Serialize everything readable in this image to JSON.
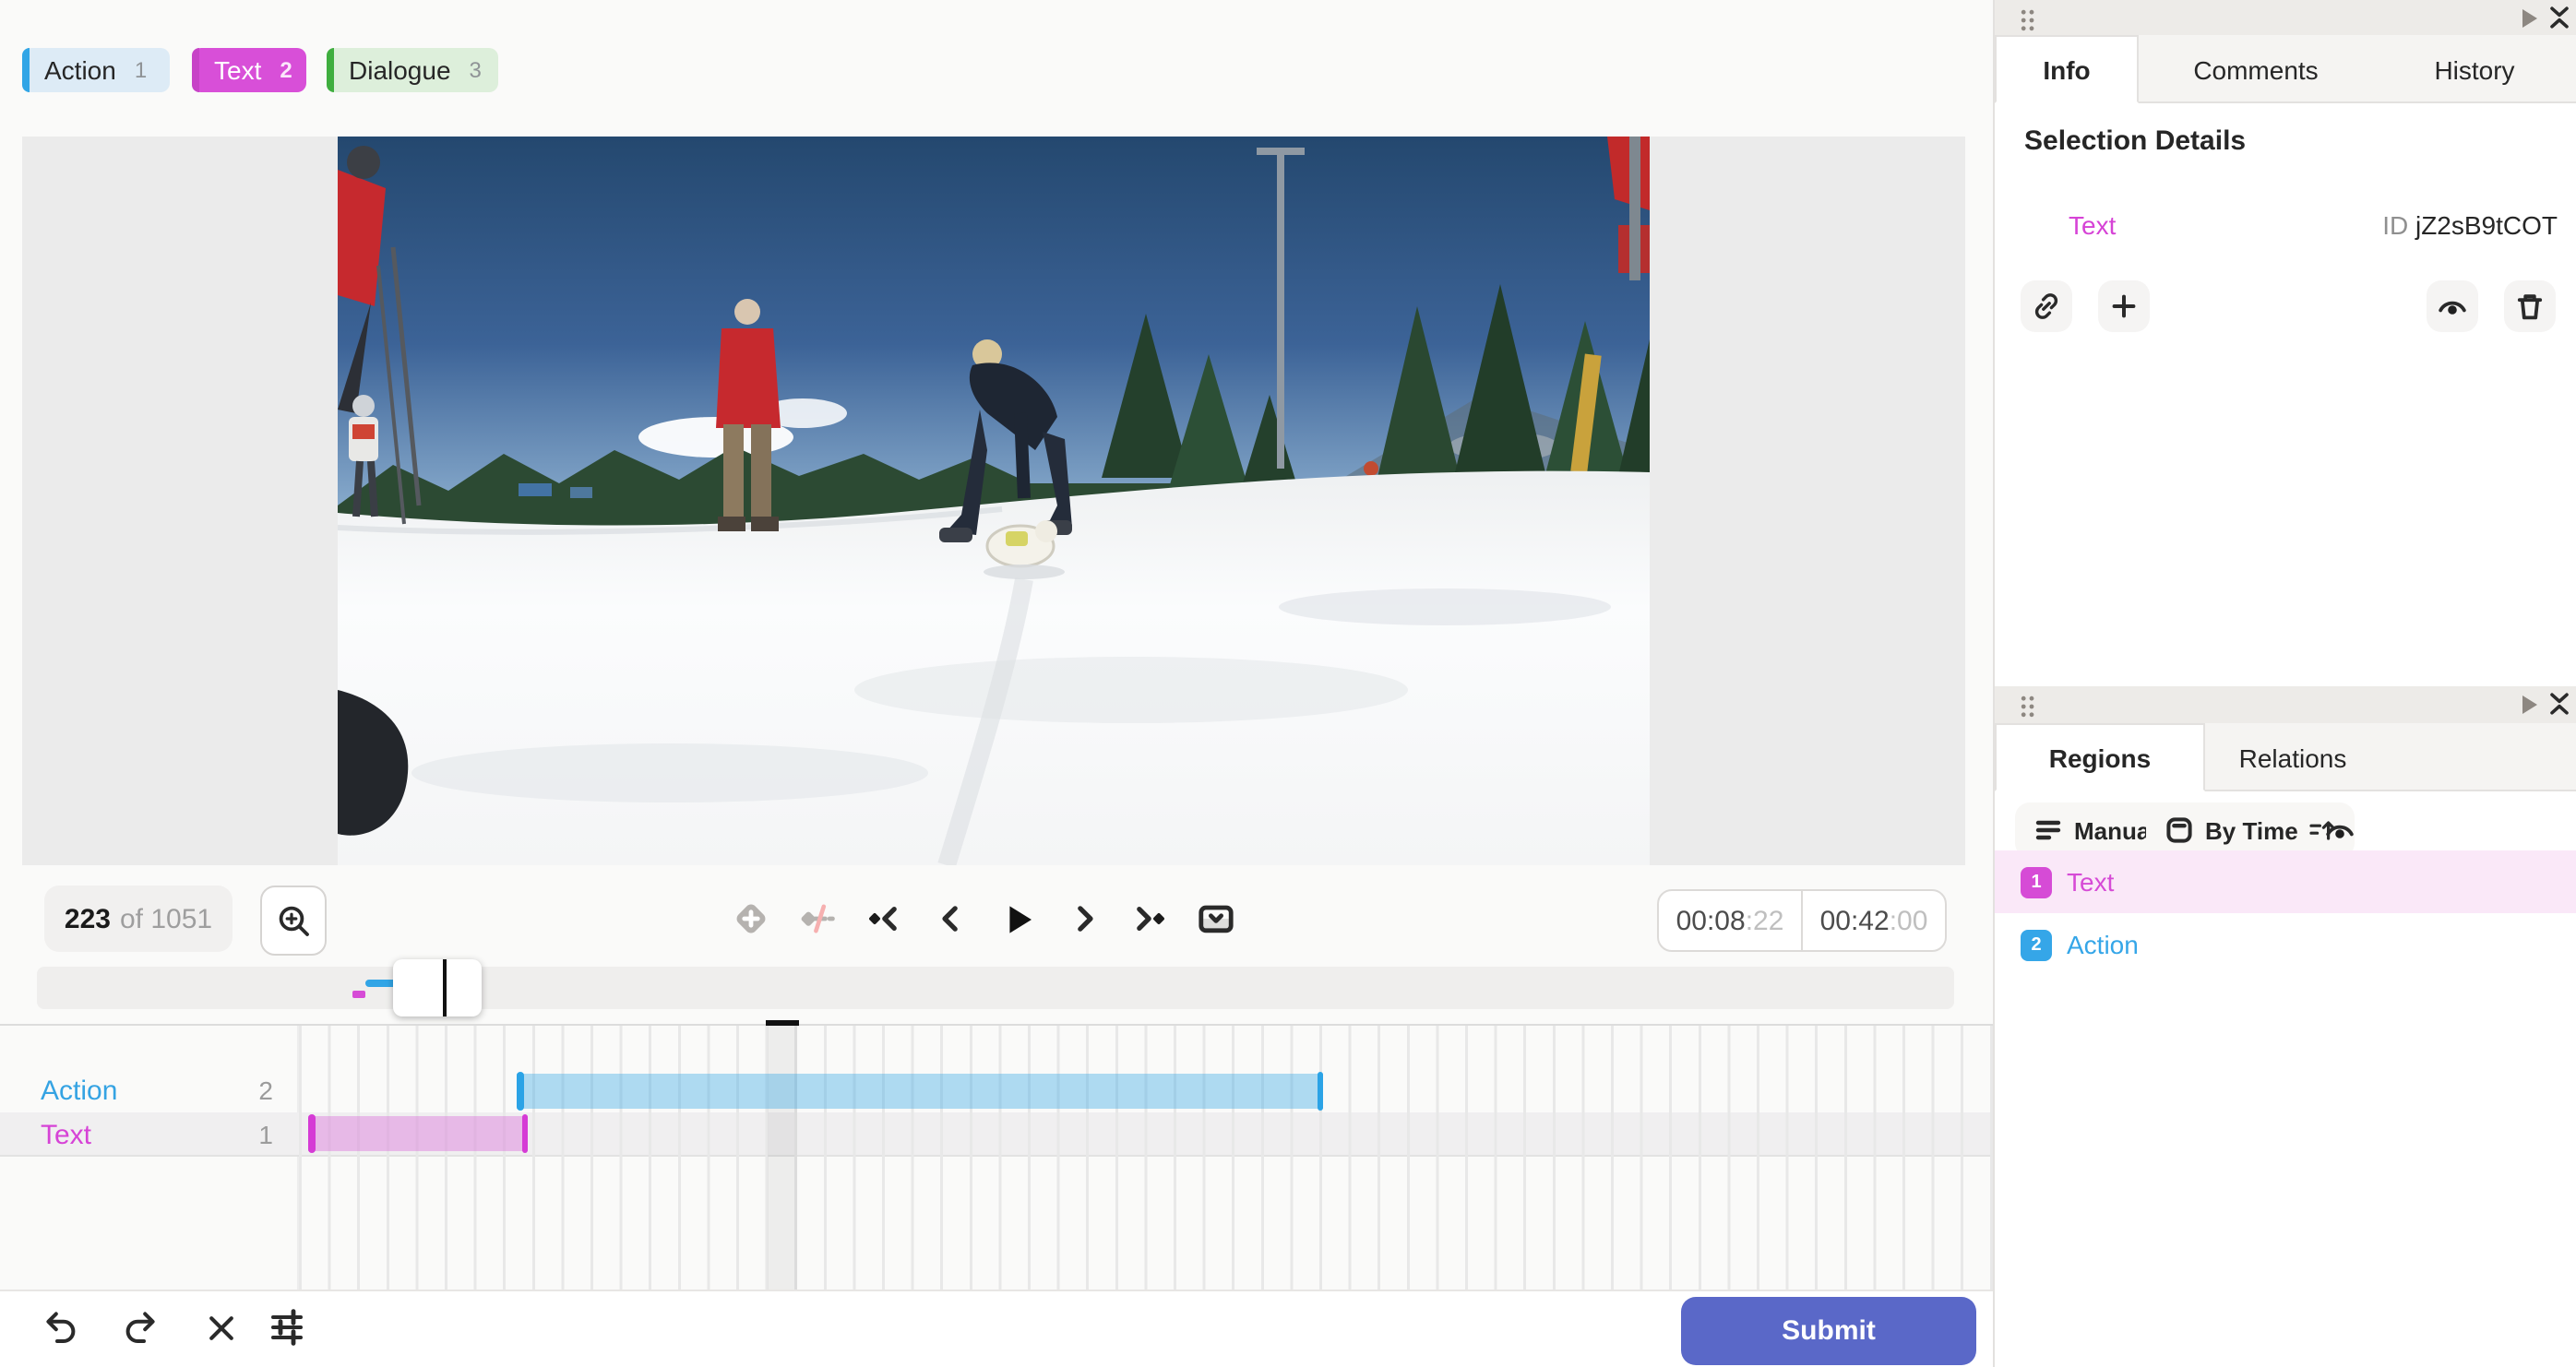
{
  "tags": [
    {
      "label": "Action",
      "hotkey": "1"
    },
    {
      "label": "Text",
      "hotkey": "2"
    },
    {
      "label": "Dialogue",
      "hotkey": "3"
    }
  ],
  "player": {
    "frame_current": "223",
    "frame_of": "of 1051",
    "time_position": "00:08",
    "time_position_frames": ":22",
    "time_duration": "00:42",
    "time_duration_frames": ":00"
  },
  "timeline": {
    "rows": [
      {
        "label": "Action",
        "count": "2"
      },
      {
        "label": "Text",
        "count": "1"
      }
    ]
  },
  "info_panel": {
    "tabs": [
      "Info",
      "Comments",
      "History"
    ],
    "heading": "Selection Details",
    "selected_label": "Text",
    "id_label": "ID",
    "id_value": "jZ2sB9tCOT"
  },
  "regions_panel": {
    "tabs": [
      "Regions",
      "Relations"
    ],
    "order_manual": "Manual",
    "order_by_time": "By Time",
    "items": [
      {
        "index": "1",
        "label": "Text"
      },
      {
        "index": "2",
        "label": "Action"
      }
    ]
  },
  "actions": {
    "submit": "Submit"
  },
  "colors": {
    "action_blue": "#31a5e6",
    "text_magenta": "#d64bd6",
    "dialogue_green": "#3fae3f",
    "submit_indigo": "#5a68c8",
    "danger_red": "#cf2e2e"
  }
}
